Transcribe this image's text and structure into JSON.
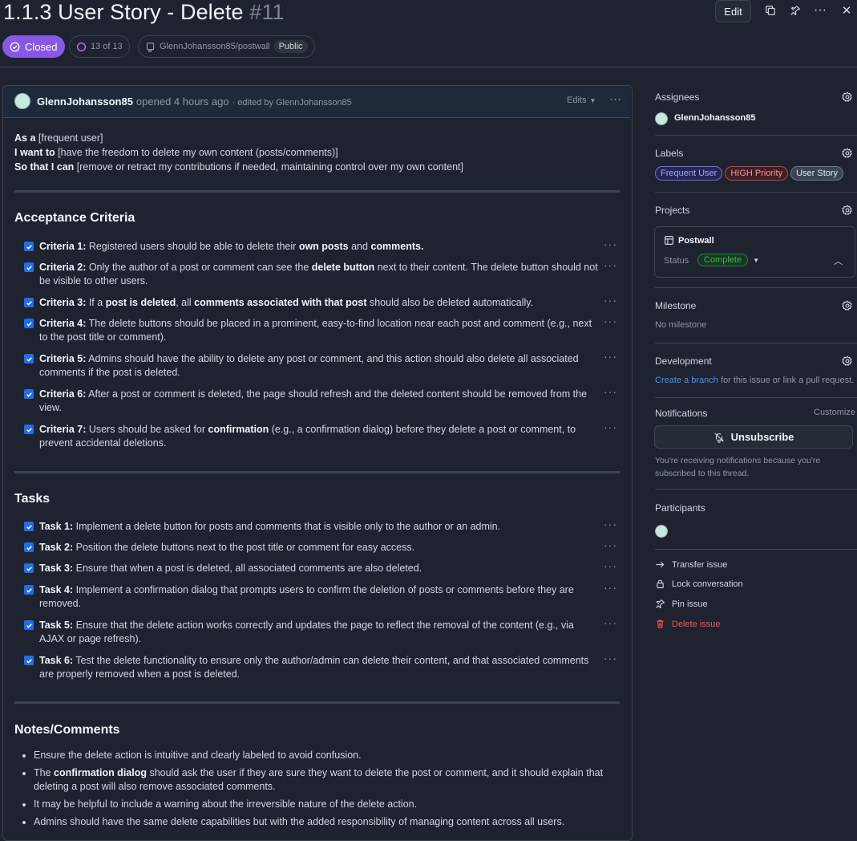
{
  "header": {
    "title": "1.1.3 User Story - Delete",
    "number": "#11",
    "edit_label": "Edit",
    "status": "Closed",
    "progress": "13 of 13",
    "repo": "GlennJohansson85/postwall",
    "visibility": "Public"
  },
  "comment": {
    "author": "GlennJohansson85",
    "opened": "opened 4 hours ago",
    "edited_by": "· edited by GlennJohansson85",
    "edits_label": "Edits",
    "intro": [
      {
        "b": "As a",
        "t": " [frequent user]"
      },
      {
        "b": "I want to",
        "t": " [have the freedom to delete my own content (posts/comments)]"
      },
      {
        "b": "So that I can",
        "t": " [remove or retract my contributions if needed, maintaining control over my own content]"
      }
    ],
    "acceptance_title": "Acceptance Criteria",
    "criteria": [
      "<b>Criteria 1:</b> Registered users should be able to delete their <b>own posts</b> and <b>comments.</b>",
      "<b>Criteria 2:</b> Only the author of a post or comment can see the <b>delete button</b> next to their content. The delete button should not be visible to other users.",
      "<b>Criteria 3:</b> If a <b>post is deleted</b>, all <b>comments associated with that post</b> should also be deleted automatically.",
      "<b>Criteria 4:</b> The delete buttons should be placed in a prominent, easy-to-find location near each post and comment (e.g., next to the post title or comment).",
      "<b>Criteria 5:</b> Admins should have the ability to delete any post or comment, and this action should also delete all associated comments if the post is deleted.",
      "<b>Criteria 6:</b> After a post or comment is deleted, the page should refresh and the deleted content should be removed from the view.",
      "<b>Criteria 7:</b> Users should be asked for <b>confirmation</b> (e.g., a confirmation dialog) before they delete a post or comment, to prevent accidental deletions."
    ],
    "tasks_title": "Tasks",
    "tasks": [
      "<b>Task 1:</b> Implement a delete button for posts and comments that is visible only to the author or an admin.",
      "<b>Task 2:</b> Position the delete buttons next to the post title or comment for easy access.",
      "<b>Task 3:</b> Ensure that when a post is deleted, all associated comments are also deleted.",
      "<b>Task 4:</b> Implement a confirmation dialog that prompts users to confirm the deletion of posts or comments before they are removed.",
      "<b>Task 5:</b> Ensure that the delete action works correctly and updates the page to reflect the removal of the content (e.g., via AJAX or page refresh).",
      "<b>Task 6:</b> Test the delete functionality to ensure only the author/admin can delete their content, and that associated comments are properly removed when a post is deleted."
    ],
    "notes_title": "Notes/Comments",
    "notes": [
      "Ensure the delete action is intuitive and clearly labeled to avoid confusion.",
      "The <b>confirmation dialog</b> should ask the user if they are sure they want to delete the post or comment, and it should explain that deleting a post will also remove associated comments.",
      "It may be helpful to include a warning about the irreversible nature of the delete action.",
      "Admins should have the same delete capabilities but with the added responsibility of managing content across all users."
    ]
  },
  "sidebar": {
    "assignees_title": "Assignees",
    "assignee": "GlennJohansson85",
    "labels_title": "Labels",
    "labels": [
      {
        "text": "Frequent User",
        "color": "#a5a5ff",
        "bg": "#262653",
        "border": "#6e6ee6"
      },
      {
        "text": "HIGH Priority",
        "color": "#ff9492",
        "bg": "#3d1f24",
        "border": "#b34747"
      },
      {
        "text": "User Story",
        "color": "#e0e6ed",
        "bg": "#3a4552",
        "border": "#6b7a8a"
      }
    ],
    "projects_title": "Projects",
    "project_name": "Postwall",
    "status_label": "Status",
    "status_value": "Complete",
    "milestone_title": "Milestone",
    "milestone_value": "No milestone",
    "development_title": "Development",
    "dev_link": "Create a branch",
    "dev_text": " for this issue or link a pull request.",
    "notifications_title": "Notifications",
    "customize": "Customize",
    "unsubscribe": "Unsubscribe",
    "notif_text": "You're receiving notifications because you're subscribed to this thread.",
    "participants_title": "Participants",
    "actions": [
      {
        "label": "Transfer issue",
        "icon": "arrow-right-icon"
      },
      {
        "label": "Lock conversation",
        "icon": "lock-icon"
      },
      {
        "label": "Pin issue",
        "icon": "pin-icon"
      },
      {
        "label": "Delete issue",
        "icon": "trash-icon",
        "danger": true
      }
    ]
  },
  "colors": {
    "accent": "#1f6feb",
    "closed": "#8957e5",
    "link": "#4493f8",
    "danger": "#f85149"
  }
}
